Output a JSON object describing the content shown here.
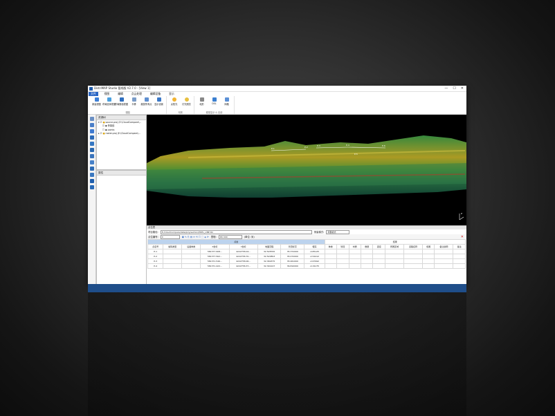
{
  "window": {
    "title": "DistriMAP Studio 管线版 V2.7.0 - [View 1]",
    "controls": [
      "—",
      "☐",
      "✕"
    ]
  },
  "menu": [
    "文件",
    "视图",
    "编辑",
    "点云处理",
    "编辑设备",
    "显示"
  ],
  "ribbon": {
    "groups": [
      {
        "label": "视图",
        "buttons": [
          "新建视图",
          "布局选择视图",
          "布局断面视图",
          "平移",
          "缩放所有点",
          "显示设置"
        ]
      },
      {
        "label": "光照",
        "buttons": [
          "太阳光",
          "灯光照亮"
        ]
      },
      {
        "label": "模型显示 & 法线",
        "buttons": [
          "地形",
          "DSL",
          "网格"
        ]
      }
    ]
  },
  "panels": {
    "resources": {
      "title": "资源树",
      "items": [
        "source.proj (E:\\CloudCompare\\...",
        "骨架线",
        "points",
        "raster.proj (E:\\CloudCompare\\..."
      ]
    },
    "properties": {
      "title": "属性"
    }
  },
  "viewer": {
    "labels": [
      "P-1",
      "P-2",
      "P-3",
      "P-4",
      "P-5",
      "P-6"
    ],
    "axis": "Z"
  },
  "bottom": {
    "title": "点位表",
    "path_label": "项目路径:",
    "path": "E:/CloudCompare/data/proj/section/PDPL_LINE.tbl",
    "type_label": "测量模式:",
    "type_value": "测量模式",
    "interval_label": "点位编号:",
    "interval_value": "0",
    "unit_label": "里程:",
    "unit_value": "DK 000",
    "unit_suffix": "(单位: 米)",
    "group_left": "点坐",
    "group_right": "结果",
    "columns": [
      "点名号",
      "编码类型",
      "设备种类",
      "X坐标",
      "Y坐标",
      "地面高程",
      "管顶标高",
      "埋深",
      "种类",
      "管径",
      "材质",
      "数量",
      "连接",
      "所属区域",
      "道路名称",
      "权属",
      "备注说明",
      "备注"
    ],
    "rows": [
      [
        "P-1",
        "",
        "",
        "581377.908...",
        "4222758.04...",
        "32.528795",
        "35.372000",
        "-0.85125"
      ],
      [
        "P-2",
        "",
        "",
        "581377.562...",
        "4222758.70...",
        "32.520893",
        "35.072000",
        "-2.54412"
      ],
      [
        "P-3",
        "",
        "",
        "581371.546...",
        "4222758.06...",
        "32.369375",
        "35.061000",
        "-2.67992"
      ],
      [
        "P-4",
        "",
        "",
        "581371.422...",
        "4222758.37...",
        "32.391247",
        "36.810000",
        "-4.34175"
      ]
    ]
  },
  "colors": {
    "accent": "#2b66c4",
    "brand_bar": "#1f4e8a"
  }
}
